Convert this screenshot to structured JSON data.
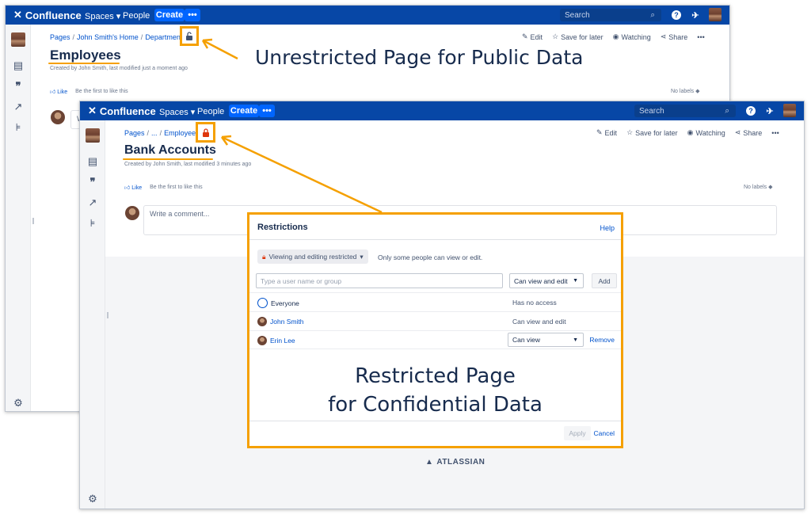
{
  "brand": {
    "product": "Confluence",
    "footer": "ATLASSIAN"
  },
  "colors": {
    "topbar": "#0747a6",
    "create": "#0065ff",
    "highlight": "#f5a000",
    "link": "#0052cc"
  },
  "nav": {
    "spaces": "Spaces",
    "people": "People",
    "create": "Create",
    "more": "•••",
    "search_placeholder": "Search"
  },
  "back_page": {
    "breadcrumbs": [
      "Pages",
      "John Smith's Home",
      "Departments"
    ],
    "title": "Employees",
    "meta": "Created by John Smith, last modified just a moment ago",
    "actions": {
      "edit": "Edit",
      "save": "Save for later",
      "watch": "Watching",
      "share": "Share",
      "more": "•••"
    },
    "like": "Like",
    "like_hint": "Be the first to like this",
    "labels": "No labels",
    "comment_stub": "W",
    "lock_icon": "unlocked-icon"
  },
  "front_page": {
    "breadcrumbs": [
      "Pages",
      "...",
      "Employees"
    ],
    "title": "Bank Accounts",
    "meta": "Created by John Smith, last modified 3 minutes ago",
    "actions": {
      "edit": "Edit",
      "save": "Save for later",
      "watch": "Watching",
      "share": "Share",
      "more": "•••"
    },
    "like": "Like",
    "like_hint": "Be the first to like this",
    "labels": "No labels",
    "comment_placeholder": "Write a comment...",
    "lock_icon": "locked-icon"
  },
  "callouts": {
    "public": "Unrestricted Page for Public Data",
    "confidential_line1": "Restricted Page",
    "confidential_line2": "for Confidential Data"
  },
  "dialog": {
    "title": "Restrictions",
    "help": "Help",
    "mode": "Viewing and editing restricted",
    "mode_desc": "Only some people can view or edit.",
    "user_placeholder": "Type a user name or group",
    "new_permission": "Can view and edit",
    "add": "Add",
    "rows": [
      {
        "name": "Everyone",
        "permission": "Has no access"
      },
      {
        "name": "John Smith",
        "permission": "Can view and edit"
      },
      {
        "name": "Erin Lee",
        "permission": "Can view",
        "remove": "Remove"
      }
    ],
    "apply": "Apply",
    "cancel": "Cancel"
  },
  "sidebar": {
    "expand": "»"
  }
}
